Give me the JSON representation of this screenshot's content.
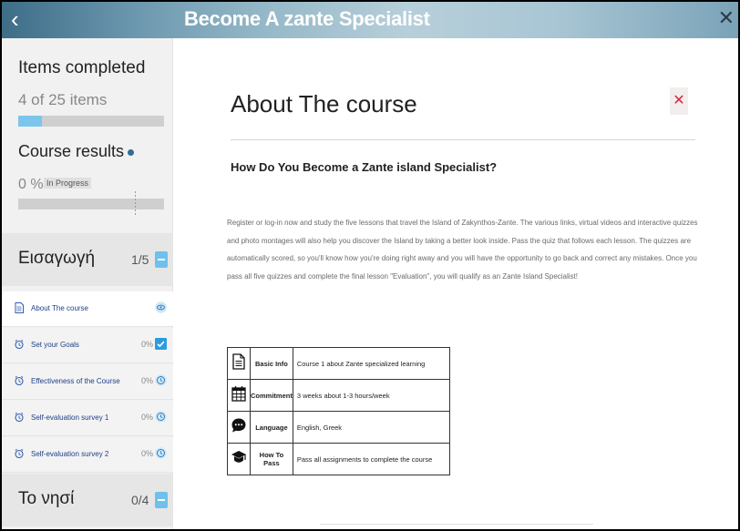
{
  "header": {
    "back_icon": "chevron-left-icon",
    "title": "Become A zante Specialist",
    "close_icon": "close-icon"
  },
  "sidebar": {
    "items_title": "Items completed",
    "items_count": "4 of 25 items",
    "items_progress": 0.16,
    "results_title": "Course results",
    "results_pct": "0 %",
    "status_badge": "In Progress",
    "sections": [
      {
        "name": "Εισαγωγή",
        "count": "1/5",
        "lessons": [
          {
            "name": "About The course",
            "pct": "",
            "status": "view",
            "icon": "document-icon"
          },
          {
            "name": "Set your Goals",
            "pct": "0%",
            "status": "done",
            "icon": "alarm-clock-icon"
          },
          {
            "name": "Effectiveness of the Course",
            "pct": "0%",
            "status": "pending",
            "icon": "alarm-clock-icon"
          },
          {
            "name": "Self-evaluation survey 1",
            "pct": "0%",
            "status": "pending",
            "icon": "alarm-clock-icon"
          },
          {
            "name": "Self-evaluation survey 2",
            "pct": "0%",
            "status": "pending",
            "icon": "alarm-clock-icon"
          }
        ]
      },
      {
        "name": "Το νησί",
        "count": "0/4",
        "lessons": []
      }
    ]
  },
  "main": {
    "title": "About The course",
    "close_label": "✕",
    "subtitle": "How Do You Become a Zante island Specialist?",
    "description": "Register or log-in now and study the five lessons that travel the Island of Zakynthos-Zante. The various links, virtual videos and interactive quizzes and photo montages will also help you discover the Island by taking a better look inside. Pass the quiz that follows each lesson. The quizzes are automatically scored, so you'll know how you're doing right away and you will have the opportunity to go back and correct any mistakes. Once you pass all five quizzes and complete the final lesson \"Evaluation\", you will qualify as an Zante Island Specialist!",
    "info_table": [
      {
        "icon": "document-icon",
        "key": "Basic Info",
        "value": "Course 1 about Zante specialized learning"
      },
      {
        "icon": "calendar-icon",
        "key": "Commitment",
        "value": "3 weeks about  1-3 hours/week"
      },
      {
        "icon": "chat-bubble-icon",
        "key": "Language",
        "value": "English, Greek"
      },
      {
        "icon": "graduation-cap-icon",
        "key": "How To Pass",
        "value": "Pass all assignments to complete the course"
      }
    ]
  },
  "colors": {
    "accent": "#6ec1ec",
    "link": "#1f3f86",
    "close_red": "#d62b3b"
  }
}
